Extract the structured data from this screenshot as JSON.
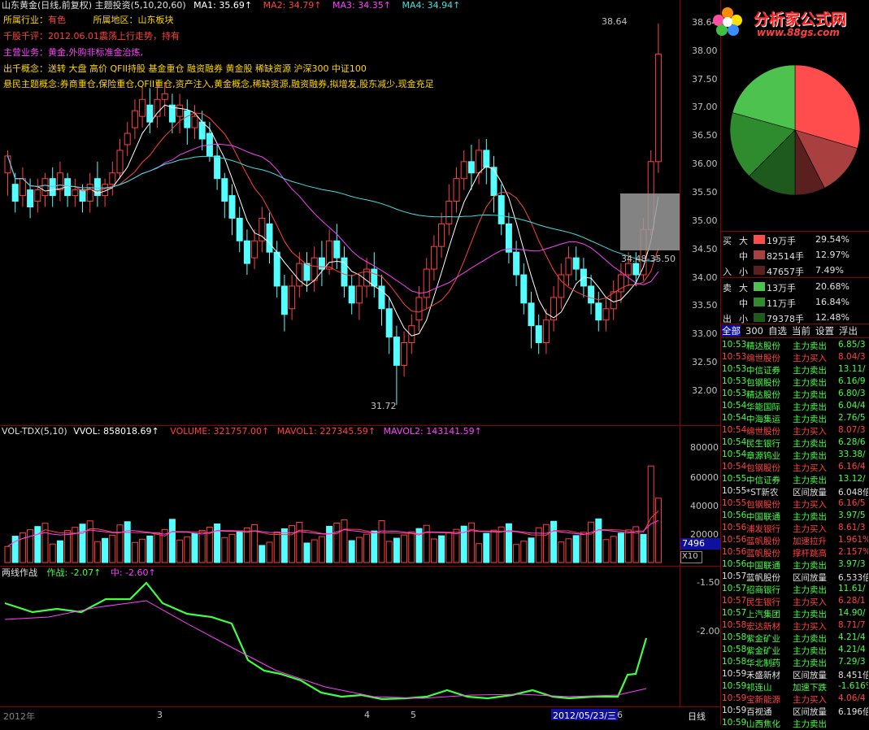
{
  "header": {
    "title": "山东黄金(日线,前复权) 主题投资(5,10,20,60)",
    "ma1": "MA1: 35.69↑",
    "ma2": "MA2: 34.79↑",
    "ma3": "MA3: 34.35↑",
    "ma4": "MA4: 34.94↑"
  },
  "info": {
    "industry_label": "所属行业：",
    "industry": "有色",
    "region_label": "所属地区：",
    "region": "山东板块",
    "review": "千股千评：2012.06.01震荡上行走势，持有",
    "business": "主营业务：黄金,外购非标准金治炼,",
    "concepts": "出千概念：送转 大盘 高价 QFII持股 基金重仓 融资融券 黄金股 稀缺资源 沪深300 中证100",
    "themes": "悬民主题概念:券商重仓,保险重仓,QFII重仓,资产注入,黄金概念,稀缺资源,融资融券,拟增发,股东减少,现金充足"
  },
  "price_axis": [
    "38.00",
    "37.50",
    "37.00",
    "36.50",
    "36.00",
    "35.50",
    "35.00",
    "34.50",
    "34.00",
    "33.50",
    "33.00",
    "32.50",
    "32.00"
  ],
  "price_top_label": "38.64",
  "high_marker": "38.64",
  "low_marker": "31.72",
  "range_marker": "34.48-35.50",
  "volume": {
    "title": "VOL-TDX(5,10)",
    "vvol": "VVOL: 858018.69↑",
    "volume": "VOLUME: 321757.00↑",
    "mavol1": "MAVOL1: 227345.59↑",
    "mavol2": "MAVOL2: 143141.59↑",
    "axis": [
      "80000",
      "60000",
      "40000",
      "20000"
    ],
    "current_box": "7496",
    "unit_box": "X10"
  },
  "indicator": {
    "title": "两线作战",
    "zuozhan": "作战: -2.07↑",
    "zhong": "中: -2.60↑",
    "axis": [
      "-1.50",
      "-2.00"
    ]
  },
  "date_axis": {
    "year": "2012年",
    "m3": "3",
    "m4": "4",
    "m5": "5",
    "m6": "6",
    "selected_date": "2012/05/23/三",
    "period": "日线"
  },
  "watermark": {
    "title": "分析家公式网",
    "url": "www.88gs.com"
  },
  "pie": {
    "slices": [
      {
        "label": "买大",
        "pct": 29.54,
        "color": "#ff4d4d"
      },
      {
        "label": "买中",
        "pct": 12.97,
        "color": "#a84040"
      },
      {
        "label": "买小",
        "pct": 7.49,
        "color": "#5a2020"
      },
      {
        "label": "卖小",
        "pct": 12.48,
        "color": "#1e5a1e"
      },
      {
        "label": "卖中",
        "pct": 16.84,
        "color": "#2e8b2e"
      },
      {
        "label": "卖大",
        "pct": 20.68,
        "color": "#4ec24e"
      }
    ]
  },
  "flow": {
    "buy": [
      {
        "side": "买",
        "size": "大",
        "amount": "19万手",
        "pct": "29.54%",
        "color": "#ff4d4d"
      },
      {
        "side": "",
        "size": "中",
        "amount": "82514手",
        "pct": "12.97%",
        "color": "#a84040"
      },
      {
        "side": "入",
        "size": "小",
        "amount": "47657手",
        "pct": "7.49%",
        "color": "#5a2020"
      }
    ],
    "sell": [
      {
        "side": "卖",
        "size": "大",
        "amount": "13万手",
        "pct": "20.68%",
        "color": "#4ec24e"
      },
      {
        "side": "",
        "size": "中",
        "amount": "11万手",
        "pct": "16.84%",
        "color": "#2e8b2e"
      },
      {
        "side": "出",
        "size": "小",
        "amount": "79378手",
        "pct": "12.48%",
        "color": "#1e5a1e"
      }
    ]
  },
  "tabs": [
    "全部",
    "300",
    "自选",
    "当前",
    "设置",
    "浮出"
  ],
  "trades": [
    {
      "time": "10:53",
      "name": "精达股份",
      "action": "主力卖出",
      "val": "6.85/3",
      "c": "g"
    },
    {
      "time": "10:53",
      "name": "绵世股份",
      "action": "主力买入",
      "val": "8.04/3",
      "c": "r"
    },
    {
      "time": "10:53",
      "name": "中信证券",
      "action": "主力卖出",
      "val": "13.11/",
      "c": "g"
    },
    {
      "time": "10:53",
      "name": "包钢股份",
      "action": "主力卖出",
      "val": "6.16/9",
      "c": "g"
    },
    {
      "time": "10:53",
      "name": "精达股份",
      "action": "主力卖出",
      "val": "6.80/3",
      "c": "g"
    },
    {
      "time": "10:54",
      "name": "华能国际",
      "action": "主力卖出",
      "val": "6.04/4",
      "c": "g"
    },
    {
      "time": "10:54",
      "name": "中海集运",
      "action": "主力卖出",
      "val": "2.76/5",
      "c": "g"
    },
    {
      "time": "10:54",
      "name": "绵世股份",
      "action": "主力买入",
      "val": "8.07/3",
      "c": "r"
    },
    {
      "time": "10:54",
      "name": "民生银行",
      "action": "主力卖出",
      "val": "6.28/6",
      "c": "g"
    },
    {
      "time": "10:54",
      "name": "章源钨业",
      "action": "主力卖出",
      "val": "33.38/",
      "c": "g"
    },
    {
      "time": "10:54",
      "name": "包钢股份",
      "action": "主力买入",
      "val": "6.16/4",
      "c": "r"
    },
    {
      "time": "10:55",
      "name": "中信证券",
      "action": "主力卖出",
      "val": "13.12/",
      "c": "g"
    },
    {
      "time": "10:55",
      "name": "*ST新农",
      "action": "区间放量",
      "val": "6.048倍",
      "c": "w"
    },
    {
      "time": "10:55",
      "name": "包钢股份",
      "action": "主力买入",
      "val": "6.16/5",
      "c": "r"
    },
    {
      "time": "10:56",
      "name": "中国联通",
      "action": "主力卖出",
      "val": "3.97/5",
      "c": "g"
    },
    {
      "time": "10:56",
      "name": "浦发银行",
      "action": "主力买入",
      "val": "8.61/3",
      "c": "r"
    },
    {
      "time": "10:56",
      "name": "蓝帆股份",
      "action": "加速拉升",
      "val": "1.961%",
      "c": "r"
    },
    {
      "time": "10:56",
      "name": "蓝帆股份",
      "action": "撑杆跳高",
      "val": "2.157%",
      "c": "r"
    },
    {
      "time": "10:56",
      "name": "中国联通",
      "action": "主力卖出",
      "val": "3.97/3",
      "c": "g"
    },
    {
      "time": "10:57",
      "name": "蓝帆股份",
      "action": "区间放量",
      "val": "6.533倍",
      "c": "w"
    },
    {
      "time": "10:57",
      "name": "招商银行",
      "action": "主力卖出",
      "val": "11.61/",
      "c": "g"
    },
    {
      "time": "10:57",
      "name": "民生银行",
      "action": "主力买入",
      "val": "6.28/1",
      "c": "r"
    },
    {
      "time": "10:57",
      "name": "上汽集团",
      "action": "主力卖出",
      "val": "14.90/",
      "c": "g"
    },
    {
      "time": "10:58",
      "name": "宏达新材",
      "action": "主力买入",
      "val": "8.71/7",
      "c": "r"
    },
    {
      "time": "10:58",
      "name": "紫金矿业",
      "action": "主力卖出",
      "val": "4.21/4",
      "c": "g"
    },
    {
      "time": "10:58",
      "name": "紫金矿业",
      "action": "主力卖出",
      "val": "4.21/4",
      "c": "g"
    },
    {
      "time": "10:58",
      "name": "华北制药",
      "action": "主力卖出",
      "val": "7.29/3",
      "c": "g"
    },
    {
      "time": "10:59",
      "name": "禾盛新材",
      "action": "区间放量",
      "val": "8.451倍",
      "c": "w"
    },
    {
      "time": "10:59",
      "name": "祁连山",
      "action": "加速下跌",
      "val": "-1.616%",
      "c": "g"
    },
    {
      "time": "10:59",
      "name": "宝新能源",
      "action": "主力买入",
      "val": "4.06/4",
      "c": "r"
    },
    {
      "time": "10:59",
      "name": "百视通",
      "action": "区间放量",
      "val": "6.196倍",
      "c": "w"
    },
    {
      "time": "10:59",
      "name": "山西焦化",
      "action": "主力卖出",
      "val": "",
      "c": "g"
    }
  ]
}
